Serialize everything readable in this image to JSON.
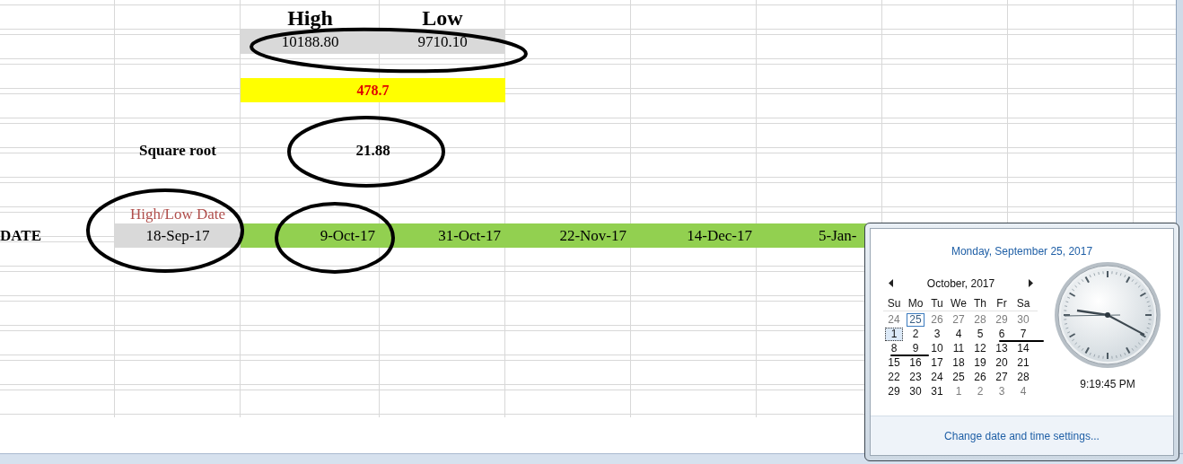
{
  "sheet": {
    "headers": [
      "High",
      "Low"
    ],
    "values": [
      "10188.80",
      "9710.10"
    ],
    "difference": "478.7",
    "square_root_label": "Square root",
    "square_root": "21.88",
    "high_low_date_label": "High/Low Date",
    "date_row_label": "DATE",
    "high_low_date": "18-Sep-17",
    "dates": [
      "9-Oct-17",
      "31-Oct-17",
      "22-Nov-17",
      "14-Dec-17",
      "5-Jan-"
    ]
  },
  "calendar_popup": {
    "long_date": "Monday, September 25, 2017",
    "month_title": "October, 2017",
    "weekdays": [
      "Su",
      "Mo",
      "Tu",
      "We",
      "Th",
      "Fr",
      "Sa"
    ],
    "weeks": [
      [
        {
          "day": "24",
          "muted": true,
          "today": false,
          "selected": false
        },
        {
          "day": "25",
          "muted": true,
          "today": true,
          "selected": false
        },
        {
          "day": "26",
          "muted": true,
          "today": false,
          "selected": false
        },
        {
          "day": "27",
          "muted": true,
          "today": false,
          "selected": false
        },
        {
          "day": "28",
          "muted": true,
          "today": false,
          "selected": false
        },
        {
          "day": "29",
          "muted": true,
          "today": false,
          "selected": false
        },
        {
          "day": "30",
          "muted": true,
          "today": false,
          "selected": false
        }
      ],
      [
        {
          "day": "1",
          "muted": false,
          "today": false,
          "selected": true
        },
        {
          "day": "2",
          "muted": false,
          "today": false,
          "selected": false
        },
        {
          "day": "3",
          "muted": false,
          "today": false,
          "selected": false
        },
        {
          "day": "4",
          "muted": false,
          "today": false,
          "selected": false
        },
        {
          "day": "5",
          "muted": false,
          "today": false,
          "selected": false
        },
        {
          "day": "6",
          "muted": false,
          "today": false,
          "selected": false
        },
        {
          "day": "7",
          "muted": false,
          "today": false,
          "selected": false
        }
      ],
      [
        {
          "day": "8",
          "muted": false,
          "today": false,
          "selected": false
        },
        {
          "day": "9",
          "muted": false,
          "today": false,
          "selected": false
        },
        {
          "day": "10",
          "muted": false,
          "today": false,
          "selected": false
        },
        {
          "day": "11",
          "muted": false,
          "today": false,
          "selected": false
        },
        {
          "day": "12",
          "muted": false,
          "today": false,
          "selected": false
        },
        {
          "day": "13",
          "muted": false,
          "today": false,
          "selected": false
        },
        {
          "day": "14",
          "muted": false,
          "today": false,
          "selected": false
        }
      ],
      [
        {
          "day": "15",
          "muted": false,
          "today": false,
          "selected": false
        },
        {
          "day": "16",
          "muted": false,
          "today": false,
          "selected": false
        },
        {
          "day": "17",
          "muted": false,
          "today": false,
          "selected": false
        },
        {
          "day": "18",
          "muted": false,
          "today": false,
          "selected": false
        },
        {
          "day": "19",
          "muted": false,
          "today": false,
          "selected": false
        },
        {
          "day": "20",
          "muted": false,
          "today": false,
          "selected": false
        },
        {
          "day": "21",
          "muted": false,
          "today": false,
          "selected": false
        }
      ],
      [
        {
          "day": "22",
          "muted": false,
          "today": false,
          "selected": false
        },
        {
          "day": "23",
          "muted": false,
          "today": false,
          "selected": false
        },
        {
          "day": "24",
          "muted": false,
          "today": false,
          "selected": false
        },
        {
          "day": "25",
          "muted": false,
          "today": false,
          "selected": false
        },
        {
          "day": "26",
          "muted": false,
          "today": false,
          "selected": false
        },
        {
          "day": "27",
          "muted": false,
          "today": false,
          "selected": false
        },
        {
          "day": "28",
          "muted": false,
          "today": false,
          "selected": false
        }
      ],
      [
        {
          "day": "29",
          "muted": false,
          "today": false,
          "selected": false
        },
        {
          "day": "30",
          "muted": false,
          "today": false,
          "selected": false
        },
        {
          "day": "31",
          "muted": false,
          "today": false,
          "selected": false
        },
        {
          "day": "1",
          "muted": true,
          "today": false,
          "selected": false
        },
        {
          "day": "2",
          "muted": true,
          "today": false,
          "selected": false
        },
        {
          "day": "3",
          "muted": true,
          "today": false,
          "selected": false
        },
        {
          "day": "4",
          "muted": true,
          "today": false,
          "selected": false
        }
      ]
    ],
    "time": "9:19:45 PM",
    "settings_link": "Change date and time settings..."
  }
}
